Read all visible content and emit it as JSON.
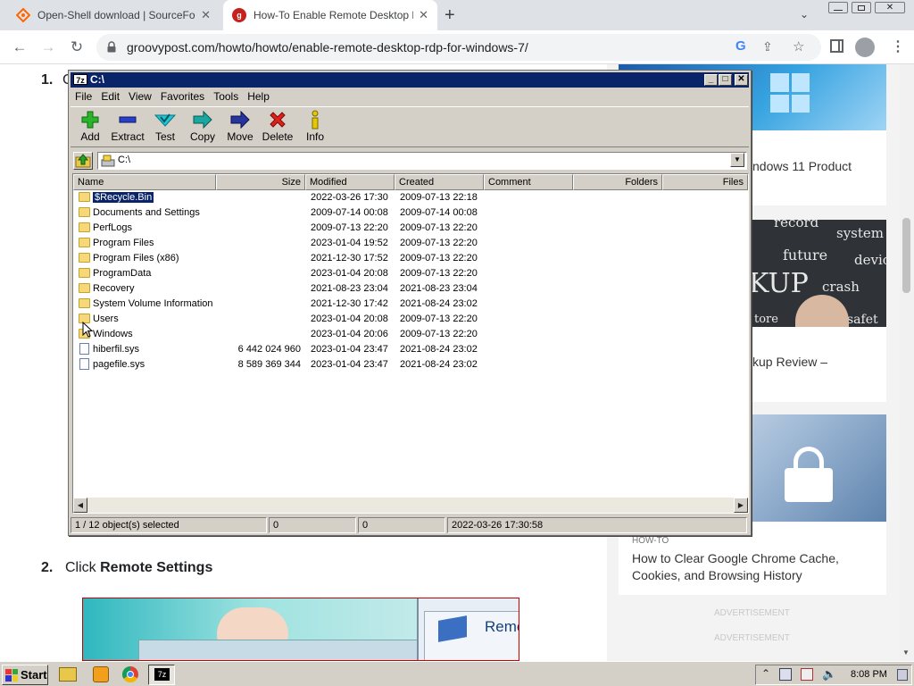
{
  "browser": {
    "tabs": [
      {
        "title": "Open-Shell download | SourceForge",
        "active": false,
        "icon": "sourceforge-icon"
      },
      {
        "title": "How-To Enable Remote Desktop RDP",
        "active": true,
        "icon": "groovypost-icon"
      }
    ],
    "url": "groovypost.com/howto/howto/enable-remote-desktop-rdp-for-windows-7/"
  },
  "article": {
    "step1_num": "1.",
    "step1_frag": "C",
    "step2_num": "2.",
    "step2_text": "Click ",
    "step2_bold": "Remote Settings",
    "img_text": "Remo"
  },
  "sidebar": {
    "card1_text": "ndows 11 Product",
    "card2_text": "kup Review –",
    "card3_category": "HOW-TO",
    "card3_title": "How to Clear Google Chrome Cache, Cookies, and Browsing History",
    "ad1": "ADVERTISEMENT",
    "ad2": "ADVERTISEMENT",
    "chalk": {
      "w1": "record",
      "w2": "system",
      "w3": "future",
      "w4": "devic",
      "w5": "KUP",
      "w6": "crash",
      "w7": "safet",
      "w8": "tore"
    }
  },
  "sevenzip": {
    "title": "C:\\",
    "title_badge": "7z",
    "menu": [
      "File",
      "Edit",
      "View",
      "Favorites",
      "Tools",
      "Help"
    ],
    "toolbar": [
      "Add",
      "Extract",
      "Test",
      "Copy",
      "Move",
      "Delete",
      "Info"
    ],
    "path": "C:\\",
    "columns": [
      "Name",
      "Size",
      "Modified",
      "Created",
      "Comment",
      "Folders",
      "Files"
    ],
    "rows": [
      {
        "name": "$Recycle.Bin",
        "size": "",
        "modified": "2022-03-26 17:30",
        "created": "2009-07-13 22:18",
        "type": "folder",
        "selected": true
      },
      {
        "name": "Documents and Settings",
        "size": "",
        "modified": "2009-07-14 00:08",
        "created": "2009-07-14 00:08",
        "type": "folder"
      },
      {
        "name": "PerfLogs",
        "size": "",
        "modified": "2009-07-13 22:20",
        "created": "2009-07-13 22:20",
        "type": "folder"
      },
      {
        "name": "Program Files",
        "size": "",
        "modified": "2023-01-04 19:52",
        "created": "2009-07-13 22:20",
        "type": "folder"
      },
      {
        "name": "Program Files (x86)",
        "size": "",
        "modified": "2021-12-30 17:52",
        "created": "2009-07-13 22:20",
        "type": "folder"
      },
      {
        "name": "ProgramData",
        "size": "",
        "modified": "2023-01-04 20:08",
        "created": "2009-07-13 22:20",
        "type": "folder"
      },
      {
        "name": "Recovery",
        "size": "",
        "modified": "2021-08-23 23:04",
        "created": "2021-08-23 23:04",
        "type": "folder"
      },
      {
        "name": "System Volume Information",
        "size": "",
        "modified": "2021-12-30 17:42",
        "created": "2021-08-24 23:02",
        "type": "folder"
      },
      {
        "name": "Users",
        "size": "",
        "modified": "2023-01-04 20:08",
        "created": "2009-07-13 22:20",
        "type": "folder"
      },
      {
        "name": "Windows",
        "size": "",
        "modified": "2023-01-04 20:06",
        "created": "2009-07-13 22:20",
        "type": "folder"
      },
      {
        "name": "hiberfil.sys",
        "size": "6 442 024 960",
        "modified": "2023-01-04 23:47",
        "created": "2021-08-24 23:02",
        "type": "file"
      },
      {
        "name": "pagefile.sys",
        "size": "8 589 369 344",
        "modified": "2023-01-04 23:47",
        "created": "2021-08-24 23:02",
        "type": "file"
      }
    ],
    "status": [
      "1 / 12 object(s) selected",
      "0",
      "0",
      "2022-03-26 17:30:58"
    ]
  },
  "taskbar": {
    "start": "Start",
    "sevenzip_badge": "7z",
    "clock": "8:08 PM"
  },
  "colors": {
    "titlebar": "#0a246a",
    "sidebar_bg": "#f3f3f3",
    "folder": "#f5d879"
  }
}
